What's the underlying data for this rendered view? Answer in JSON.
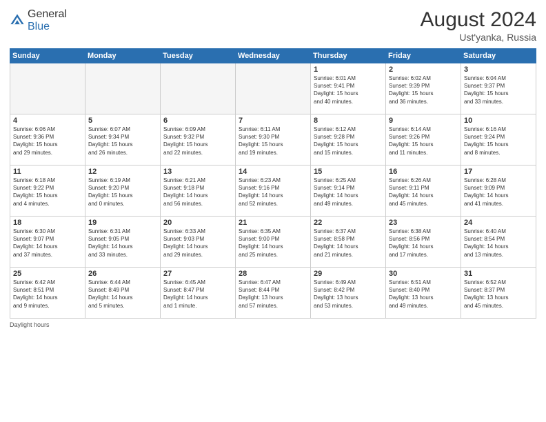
{
  "header": {
    "logo_general": "General",
    "logo_blue": "Blue",
    "month": "August 2024",
    "location": "Ust'yanka, Russia"
  },
  "days_of_week": [
    "Sunday",
    "Monday",
    "Tuesday",
    "Wednesday",
    "Thursday",
    "Friday",
    "Saturday"
  ],
  "weeks": [
    [
      {
        "day": "",
        "info": "",
        "empty": true
      },
      {
        "day": "",
        "info": "",
        "empty": true
      },
      {
        "day": "",
        "info": "",
        "empty": true
      },
      {
        "day": "",
        "info": "",
        "empty": true
      },
      {
        "day": "1",
        "info": "Sunrise: 6:01 AM\nSunset: 9:41 PM\nDaylight: 15 hours\nand 40 minutes.",
        "empty": false
      },
      {
        "day": "2",
        "info": "Sunrise: 6:02 AM\nSunset: 9:39 PM\nDaylight: 15 hours\nand 36 minutes.",
        "empty": false
      },
      {
        "day": "3",
        "info": "Sunrise: 6:04 AM\nSunset: 9:37 PM\nDaylight: 15 hours\nand 33 minutes.",
        "empty": false
      }
    ],
    [
      {
        "day": "4",
        "info": "Sunrise: 6:06 AM\nSunset: 9:36 PM\nDaylight: 15 hours\nand 29 minutes.",
        "empty": false
      },
      {
        "day": "5",
        "info": "Sunrise: 6:07 AM\nSunset: 9:34 PM\nDaylight: 15 hours\nand 26 minutes.",
        "empty": false
      },
      {
        "day": "6",
        "info": "Sunrise: 6:09 AM\nSunset: 9:32 PM\nDaylight: 15 hours\nand 22 minutes.",
        "empty": false
      },
      {
        "day": "7",
        "info": "Sunrise: 6:11 AM\nSunset: 9:30 PM\nDaylight: 15 hours\nand 19 minutes.",
        "empty": false
      },
      {
        "day": "8",
        "info": "Sunrise: 6:12 AM\nSunset: 9:28 PM\nDaylight: 15 hours\nand 15 minutes.",
        "empty": false
      },
      {
        "day": "9",
        "info": "Sunrise: 6:14 AM\nSunset: 9:26 PM\nDaylight: 15 hours\nand 11 minutes.",
        "empty": false
      },
      {
        "day": "10",
        "info": "Sunrise: 6:16 AM\nSunset: 9:24 PM\nDaylight: 15 hours\nand 8 minutes.",
        "empty": false
      }
    ],
    [
      {
        "day": "11",
        "info": "Sunrise: 6:18 AM\nSunset: 9:22 PM\nDaylight: 15 hours\nand 4 minutes.",
        "empty": false
      },
      {
        "day": "12",
        "info": "Sunrise: 6:19 AM\nSunset: 9:20 PM\nDaylight: 15 hours\nand 0 minutes.",
        "empty": false
      },
      {
        "day": "13",
        "info": "Sunrise: 6:21 AM\nSunset: 9:18 PM\nDaylight: 14 hours\nand 56 minutes.",
        "empty": false
      },
      {
        "day": "14",
        "info": "Sunrise: 6:23 AM\nSunset: 9:16 PM\nDaylight: 14 hours\nand 52 minutes.",
        "empty": false
      },
      {
        "day": "15",
        "info": "Sunrise: 6:25 AM\nSunset: 9:14 PM\nDaylight: 14 hours\nand 49 minutes.",
        "empty": false
      },
      {
        "day": "16",
        "info": "Sunrise: 6:26 AM\nSunset: 9:11 PM\nDaylight: 14 hours\nand 45 minutes.",
        "empty": false
      },
      {
        "day": "17",
        "info": "Sunrise: 6:28 AM\nSunset: 9:09 PM\nDaylight: 14 hours\nand 41 minutes.",
        "empty": false
      }
    ],
    [
      {
        "day": "18",
        "info": "Sunrise: 6:30 AM\nSunset: 9:07 PM\nDaylight: 14 hours\nand 37 minutes.",
        "empty": false
      },
      {
        "day": "19",
        "info": "Sunrise: 6:31 AM\nSunset: 9:05 PM\nDaylight: 14 hours\nand 33 minutes.",
        "empty": false
      },
      {
        "day": "20",
        "info": "Sunrise: 6:33 AM\nSunset: 9:03 PM\nDaylight: 14 hours\nand 29 minutes.",
        "empty": false
      },
      {
        "day": "21",
        "info": "Sunrise: 6:35 AM\nSunset: 9:00 PM\nDaylight: 14 hours\nand 25 minutes.",
        "empty": false
      },
      {
        "day": "22",
        "info": "Sunrise: 6:37 AM\nSunset: 8:58 PM\nDaylight: 14 hours\nand 21 minutes.",
        "empty": false
      },
      {
        "day": "23",
        "info": "Sunrise: 6:38 AM\nSunset: 8:56 PM\nDaylight: 14 hours\nand 17 minutes.",
        "empty": false
      },
      {
        "day": "24",
        "info": "Sunrise: 6:40 AM\nSunset: 8:54 PM\nDaylight: 14 hours\nand 13 minutes.",
        "empty": false
      }
    ],
    [
      {
        "day": "25",
        "info": "Sunrise: 6:42 AM\nSunset: 8:51 PM\nDaylight: 14 hours\nand 9 minutes.",
        "empty": false
      },
      {
        "day": "26",
        "info": "Sunrise: 6:44 AM\nSunset: 8:49 PM\nDaylight: 14 hours\nand 5 minutes.",
        "empty": false
      },
      {
        "day": "27",
        "info": "Sunrise: 6:45 AM\nSunset: 8:47 PM\nDaylight: 14 hours\nand 1 minute.",
        "empty": false
      },
      {
        "day": "28",
        "info": "Sunrise: 6:47 AM\nSunset: 8:44 PM\nDaylight: 13 hours\nand 57 minutes.",
        "empty": false
      },
      {
        "day": "29",
        "info": "Sunrise: 6:49 AM\nSunset: 8:42 PM\nDaylight: 13 hours\nand 53 minutes.",
        "empty": false
      },
      {
        "day": "30",
        "info": "Sunrise: 6:51 AM\nSunset: 8:40 PM\nDaylight: 13 hours\nand 49 minutes.",
        "empty": false
      },
      {
        "day": "31",
        "info": "Sunrise: 6:52 AM\nSunset: 8:37 PM\nDaylight: 13 hours\nand 45 minutes.",
        "empty": false
      }
    ]
  ],
  "footer": {
    "note": "Daylight hours"
  }
}
